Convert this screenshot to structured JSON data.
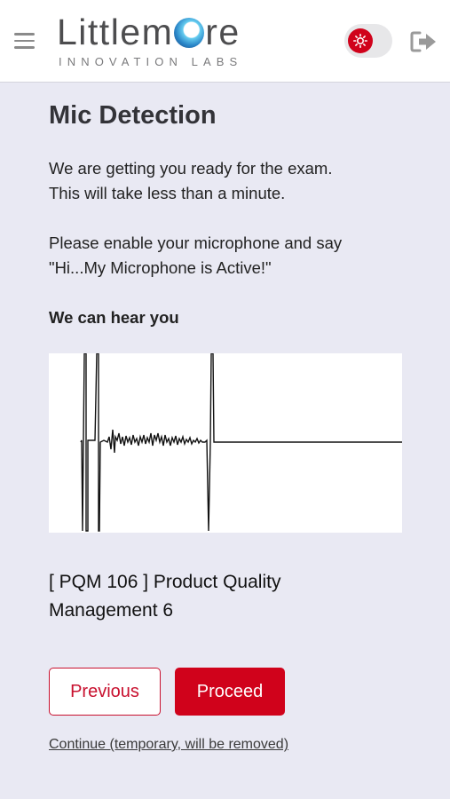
{
  "header": {
    "logo_word_left": "Littlem",
    "logo_word_right": "re",
    "logo_tagline": "INNOVATION LABS",
    "menu_icon": "hamburger-icon",
    "toggle_icon": "settings-icon",
    "logout_icon": "logout-icon",
    "accent_color": "#d0021b"
  },
  "page": {
    "title": "Mic Detection",
    "intro_line1": "We are getting you ready for the exam.",
    "intro_line2": "This will take less than a minute.",
    "instruction_line1": "Please enable your microphone and say",
    "instruction_line2": "\"Hi...My Microphone is Active!\"",
    "status": "We can hear you",
    "exam_title_line1": "[ PQM 106 ] Product Quality",
    "exam_title_line2": "Management 6"
  },
  "actions": {
    "previous_label": "Previous",
    "proceed_label": "Proceed",
    "continue_label": "Continue (temporary, will be removed)"
  }
}
